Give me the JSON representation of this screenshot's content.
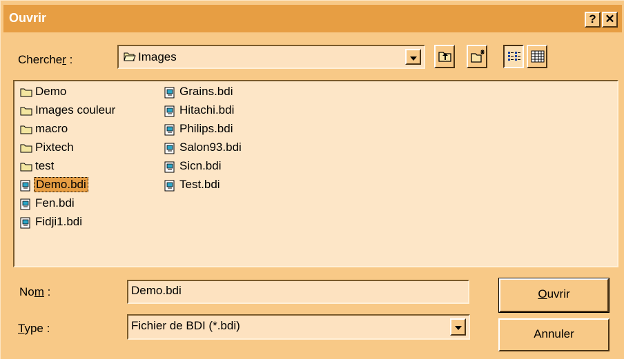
{
  "window": {
    "title": "Ouvrir",
    "help_label": "?",
    "close_label": "✕"
  },
  "lookin": {
    "label_pre": "Cherche",
    "label_u": "r",
    "label_post": " :",
    "value": "Images"
  },
  "toolbar": {
    "up_icon": "up-folder-icon",
    "new_icon": "new-folder-icon",
    "list_icon": "list-view-icon",
    "details_icon": "details-view-icon"
  },
  "files": {
    "col1": [
      {
        "name": "Demo",
        "type": "folder"
      },
      {
        "name": "Images couleur",
        "type": "folder"
      },
      {
        "name": "macro",
        "type": "folder"
      },
      {
        "name": "Pixtech",
        "type": "folder"
      },
      {
        "name": "test",
        "type": "folder"
      },
      {
        "name": "Demo.bdi",
        "type": "file",
        "selected": true
      },
      {
        "name": "Fen.bdi",
        "type": "file"
      },
      {
        "name": "Fidji1.bdi",
        "type": "file"
      }
    ],
    "col2": [
      {
        "name": "Grains.bdi",
        "type": "file"
      },
      {
        "name": "Hitachi.bdi",
        "type": "file"
      },
      {
        "name": "Philips.bdi",
        "type": "file"
      },
      {
        "name": "Salon93.bdi",
        "type": "file"
      },
      {
        "name": "Sicn.bdi",
        "type": "file"
      },
      {
        "name": "Test.bdi",
        "type": "file"
      }
    ]
  },
  "name_field": {
    "label_pre": "No",
    "label_u": "m",
    "label_post": " :",
    "value": "Demo.bdi"
  },
  "type_field": {
    "label_u": "T",
    "label_post": "ype :",
    "value": "Fichier de BDI (*.bdi)"
  },
  "buttons": {
    "open_u": "O",
    "open_rest": "uvrir",
    "cancel": "Annuler"
  },
  "colors": {
    "face": "#f8c987",
    "title": "#e79e43",
    "field": "#fde2c0",
    "list": "#fde6c7"
  }
}
